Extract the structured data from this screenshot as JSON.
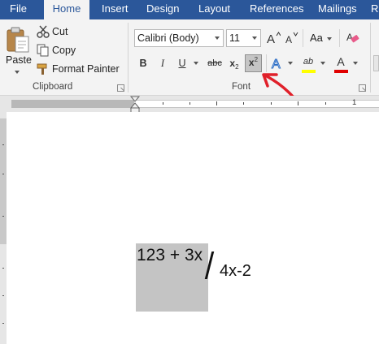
{
  "tabs": [
    {
      "label": "File"
    },
    {
      "label": "Home"
    },
    {
      "label": "Insert"
    },
    {
      "label": "Design"
    },
    {
      "label": "Layout"
    },
    {
      "label": "References"
    },
    {
      "label": "Mailings"
    },
    {
      "label": "R"
    }
  ],
  "clipboard": {
    "paste_label": "Paste",
    "cut_label": "Cut",
    "copy_label": "Copy",
    "format_painter_label": "Format Painter",
    "group_label": "Clipboard"
  },
  "font": {
    "font_name": "Calibri (Body)",
    "font_size": "11",
    "group_label": "Font",
    "bold_label": "B",
    "italic_label": "I",
    "underline_label": "U",
    "strikethrough_label": "abc",
    "subscript_base": "x",
    "subscript_index": "2",
    "superscript_base": "x",
    "superscript_index": "2",
    "change_case_label": "Aa",
    "font_color_label": "A",
    "highlight_label": "ab",
    "highlight_color": "#ffff00",
    "font_color": "#e00000",
    "superscript_active": true
  },
  "ruler": {
    "mark_1": "1"
  },
  "document": {
    "selected_text": "123 + 3x",
    "after_text": "4x-2"
  },
  "annotation": {
    "arrow_color": "#e0202a"
  },
  "colors": {
    "ribbon_blue": "#2b579a",
    "ribbon_bg": "#f3f3f3",
    "selection": "#c4c4c4"
  }
}
